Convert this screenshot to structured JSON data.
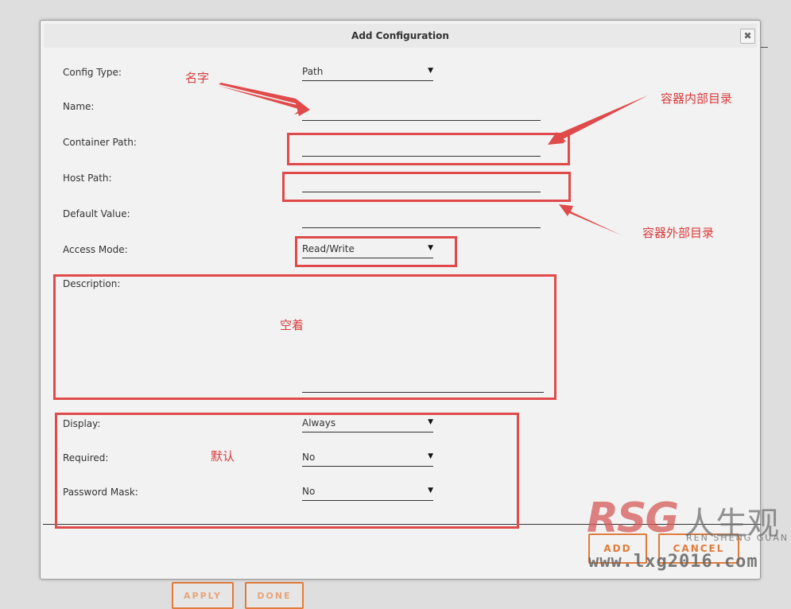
{
  "background": {
    "buttons": [
      "APPLY",
      "DONE"
    ]
  },
  "dialog": {
    "title": "Add Configuration",
    "close_label": "✖",
    "fields": {
      "config_type": {
        "label": "Config Type:",
        "value": "Path"
      },
      "name": {
        "label": "Name:",
        "value": ""
      },
      "container_path": {
        "label": "Container Path:",
        "value": ""
      },
      "host_path": {
        "label": "Host Path:",
        "value": ""
      },
      "default_value": {
        "label": "Default Value:",
        "value": ""
      },
      "access_mode": {
        "label": "Access Mode:",
        "value": "Read/Write"
      },
      "description": {
        "label": "Description:",
        "value": ""
      },
      "display": {
        "label": "Display:",
        "value": "Always"
      },
      "required": {
        "label": "Required:",
        "value": "No"
      },
      "password_mask": {
        "label": "Password Mask:",
        "value": "No"
      }
    },
    "buttons": {
      "add": "ADD",
      "cancel": "CANCEL"
    }
  },
  "annotations": {
    "name": "名字",
    "container_dir": "容器内部目录",
    "host_dir": "容器外部目录",
    "empty": "空着",
    "default": "默认"
  },
  "watermark": {
    "logo": "RSG",
    "cn": "人生观",
    "en": "REN SHENG GUAN",
    "url": "www.lxg2016.com"
  },
  "colors": {
    "accent": "#e07b3a",
    "annotation": "#e04a4a"
  }
}
